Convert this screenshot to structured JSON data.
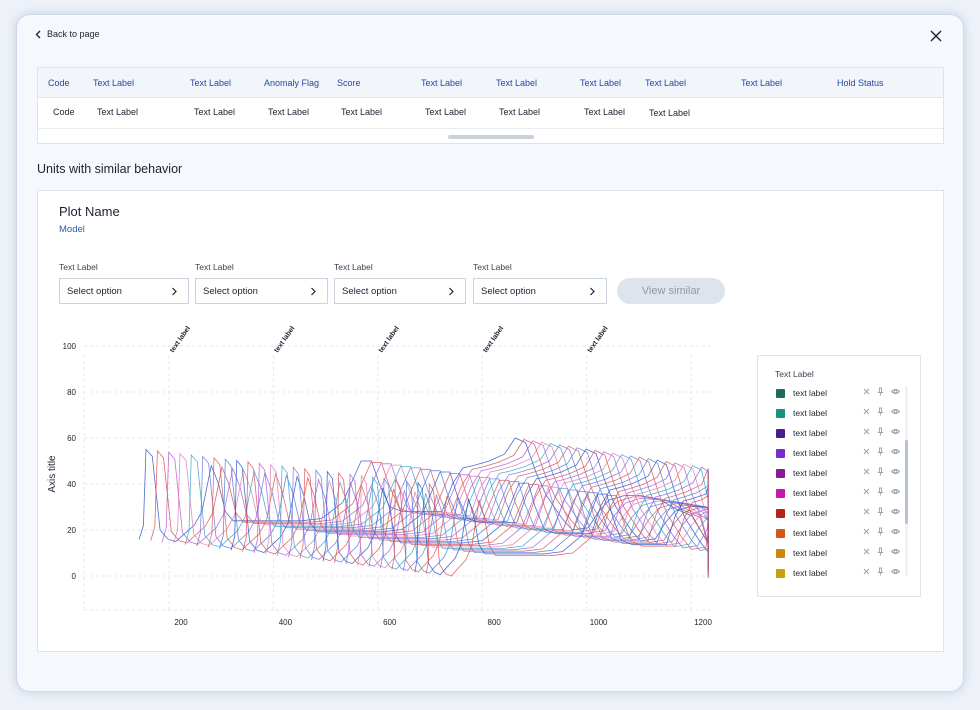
{
  "nav": {
    "back_label": "Back to page"
  },
  "table": {
    "headers": [
      "Code",
      "Text Label",
      "Text Label",
      "Anomaly Flag",
      "Score",
      "Text Label",
      "Text Label",
      "Text Label",
      "Text Label",
      "Text Label",
      "Hold Status"
    ],
    "row": [
      "Code",
      "Text Label",
      "Text Label",
      "Text Label",
      "Text Label",
      "Text Label",
      "Text Label",
      "Text Label",
      "Text Label",
      "",
      ""
    ]
  },
  "section": {
    "title": "Units with similar behavior"
  },
  "plot": {
    "name": "Plot Name",
    "model": "Model",
    "filters": [
      {
        "label": "Text Label",
        "value": "Select option"
      },
      {
        "label": "Text Label",
        "value": "Select option"
      },
      {
        "label": "Text Label",
        "value": "Select option"
      },
      {
        "label": "Text Label",
        "value": "Select option"
      }
    ],
    "view_similar_label": "View similar"
  },
  "chart_data": {
    "type": "line",
    "ylabel": "Axis title",
    "xlabel": "",
    "xlim": [
      110,
      1210
    ],
    "ylim": [
      -10,
      100
    ],
    "xticks": [
      200,
      400,
      600,
      800,
      1000,
      1200
    ],
    "yticks": [
      0,
      20,
      40,
      60,
      80,
      100
    ],
    "top_labels": [
      "text label",
      "text label",
      "text label",
      "text label",
      "text label"
    ],
    "top_label_x": [
      200,
      400,
      600,
      800,
      1000
    ],
    "grid": true,
    "series_note_count": 26,
    "base_curve": {
      "x": [
        120,
        128,
        133,
        145,
        160,
        175,
        190,
        205,
        225,
        240,
        258,
        272,
        285,
        300,
        320,
        350,
        380,
        400,
        430,
        470,
        510,
        545,
        565,
        580,
        600,
        625,
        650,
        680,
        700,
        720,
        740,
        760,
        790,
        820,
        840,
        860,
        880,
        900,
        930,
        950,
        980,
        1000,
        1020,
        1050,
        1080,
        1100,
        1120,
        1140,
        1180,
        1210
      ],
      "y": [
        16,
        22,
        55,
        52,
        20,
        16,
        15,
        18,
        22,
        28,
        48,
        40,
        28,
        24,
        24,
        24,
        24,
        24,
        24,
        25,
        32,
        50,
        50,
        40,
        30,
        28,
        28,
        28,
        28,
        40,
        47,
        48,
        50,
        53,
        60,
        58,
        45,
        35,
        25,
        20,
        21,
        28,
        33,
        35,
        35,
        34,
        33,
        30,
        26,
        14
      ]
    },
    "offset_per_series": {
      "dx": 2.2,
      "dy": 0.6
    },
    "colors": [
      "#2b54c9",
      "#e04c4c",
      "#b35bd6",
      "#e07ab0",
      "#3aa3c9",
      "#7a6ee0",
      "#d65a5a",
      "#4f7fd8"
    ]
  },
  "legend": {
    "title": "Text Label",
    "items": [
      {
        "label": "text label",
        "color": "#1e6b5c"
      },
      {
        "label": "text label",
        "color": "#17927f"
      },
      {
        "label": "text label",
        "color": "#4a1c8f"
      },
      {
        "label": "text label",
        "color": "#7a2bd0"
      },
      {
        "label": "text label",
        "color": "#8b1a93"
      },
      {
        "label": "text label",
        "color": "#c419ab"
      },
      {
        "label": "text label",
        "color": "#b3241b"
      },
      {
        "label": "text label",
        "color": "#d4561a"
      },
      {
        "label": "text label",
        "color": "#c98a0c"
      },
      {
        "label": "text label",
        "color": "#c9a10e"
      }
    ]
  }
}
